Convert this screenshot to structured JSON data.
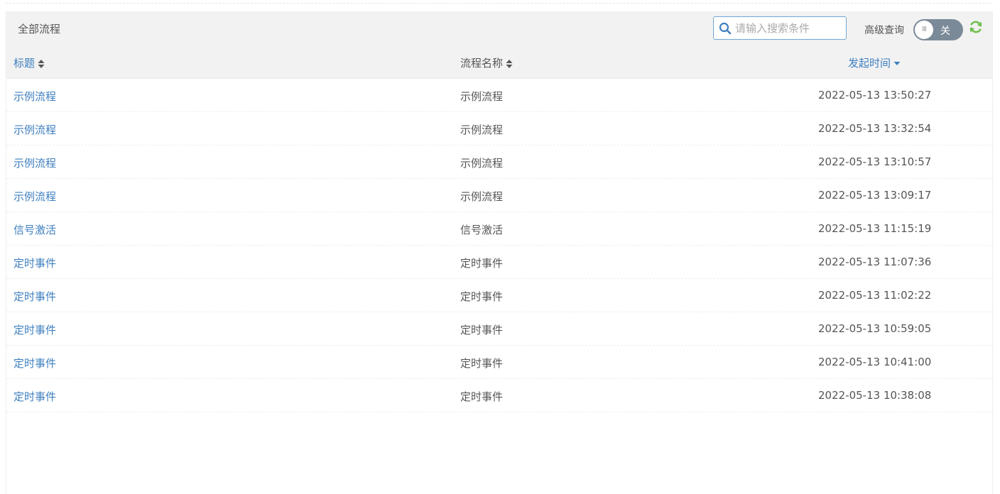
{
  "panel": {
    "title": "全部流程",
    "search": {
      "placeholder": "请输入搜索条件",
      "value": ""
    },
    "advanced_label": "高级查询",
    "toggle": {
      "knob_text": "III",
      "state_text": "关"
    }
  },
  "table": {
    "columns": {
      "title": "标题",
      "name": "流程名称",
      "time": "发起时间"
    },
    "rows": [
      {
        "title": "示例流程",
        "name": "示例流程",
        "time": "2022-05-13 13:50:27"
      },
      {
        "title": "示例流程",
        "name": "示例流程",
        "time": "2022-05-13 13:32:54"
      },
      {
        "title": "示例流程",
        "name": "示例流程",
        "time": "2022-05-13 13:10:57"
      },
      {
        "title": "示例流程",
        "name": "示例流程",
        "time": "2022-05-13 13:09:17"
      },
      {
        "title": "信号激活",
        "name": "信号激活",
        "time": "2022-05-13 11:15:19"
      },
      {
        "title": "定时事件",
        "name": "定时事件",
        "time": "2022-05-13 11:07:36"
      },
      {
        "title": "定时事件",
        "name": "定时事件",
        "time": "2022-05-13 11:02:22"
      },
      {
        "title": "定时事件",
        "name": "定时事件",
        "time": "2022-05-13 10:59:05"
      },
      {
        "title": "定时事件",
        "name": "定时事件",
        "time": "2022-05-13 10:41:00"
      },
      {
        "title": "定时事件",
        "name": "定时事件",
        "time": "2022-05-13 10:38:08"
      }
    ]
  },
  "colors": {
    "link": "#3e7fbf",
    "header_bg": "#f2f2f2",
    "toggle_bg": "#7b8a98",
    "refresh": "#6cbf4a",
    "search_border": "#6fa6d6"
  },
  "icons": {
    "search": "search-icon",
    "refresh": "refresh-icon",
    "sort_both": "sort-both-icon",
    "sort_desc": "sort-desc-icon"
  }
}
